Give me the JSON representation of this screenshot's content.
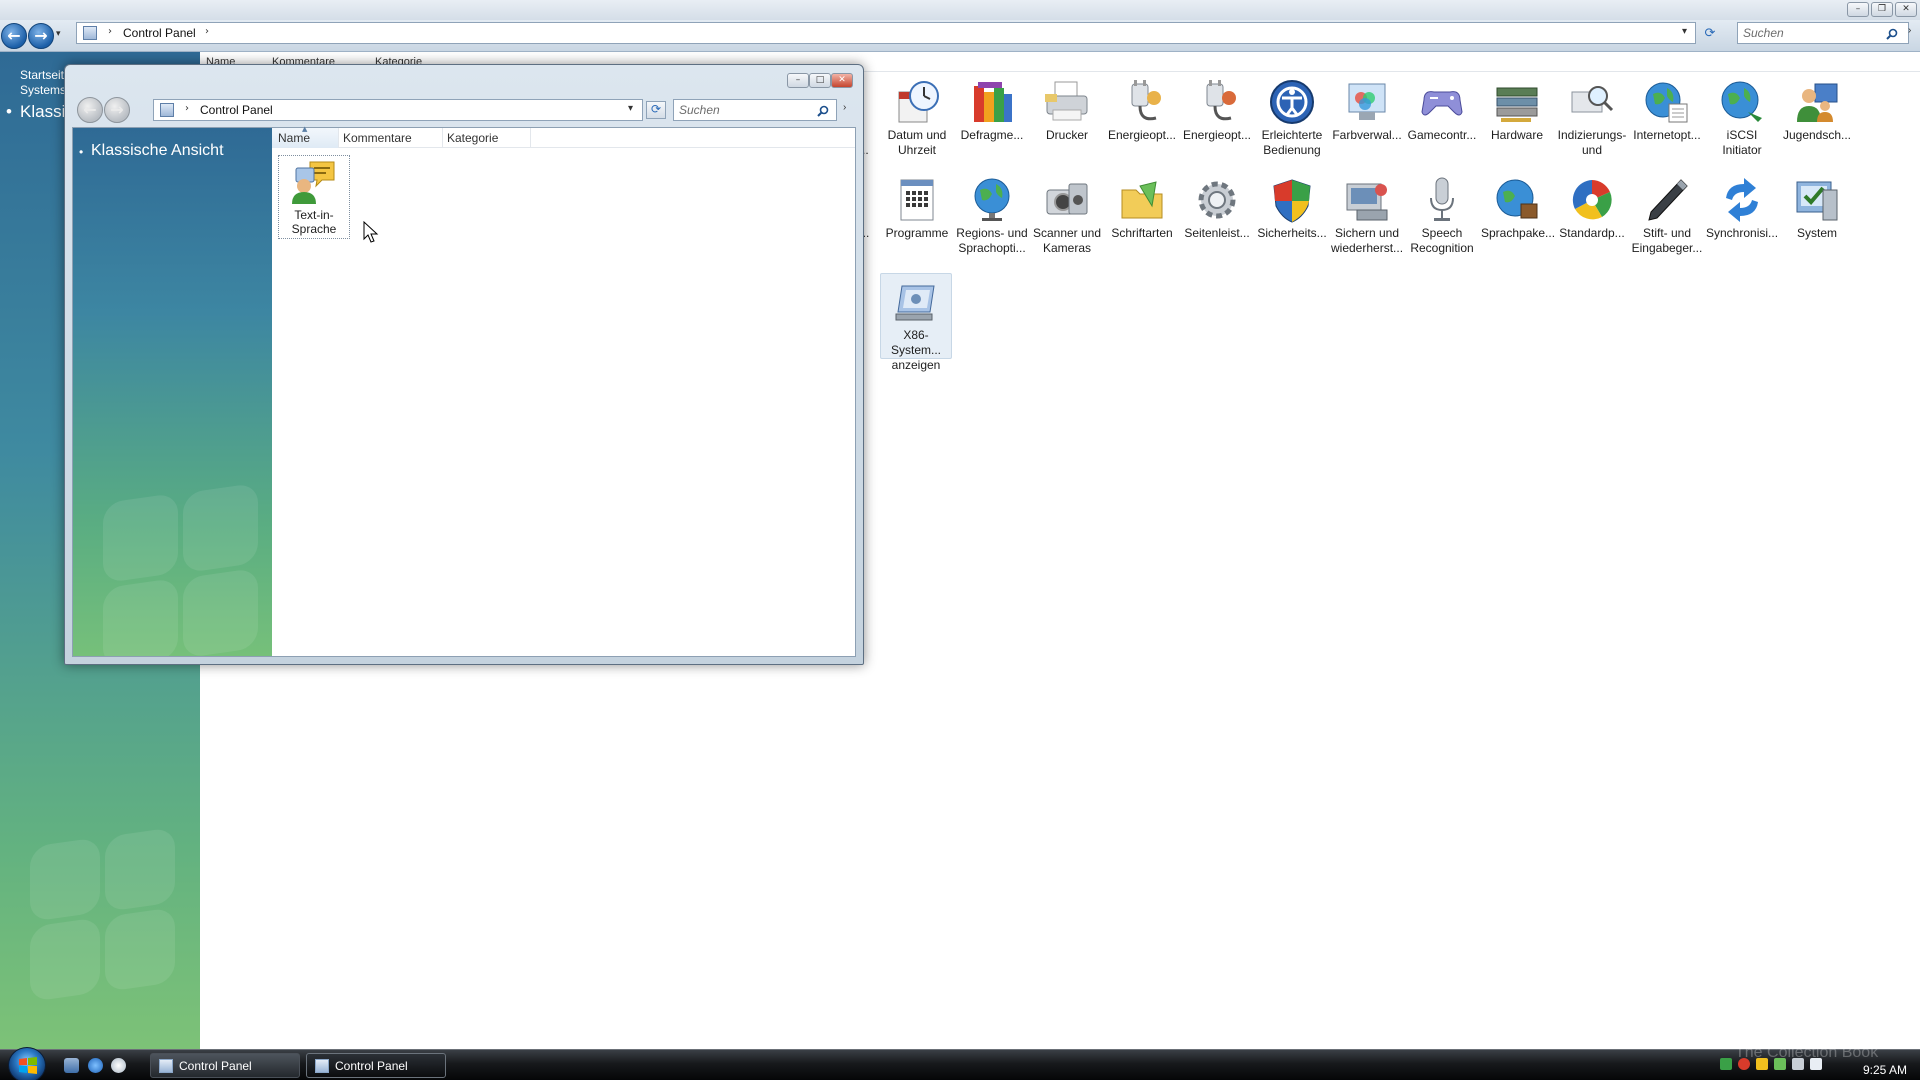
{
  "background_window": {
    "address": {
      "crumb": "Control Panel"
    },
    "search_placeholder": "Suchen",
    "sidebar": {
      "link_line1": "Startseite",
      "link_line2": "Systems",
      "classic_view": "Klassi"
    },
    "columns": [
      "Name",
      "Kommentare",
      "Kategorie"
    ],
    "icons_row1": [
      {
        "label": "d i...",
        "icon": "partial-icon"
      },
      {
        "label": "Datum und Uhrzeit",
        "icon": "clock-icon"
      },
      {
        "label": "Defragme...",
        "icon": "defragment-icon"
      },
      {
        "label": "Drucker",
        "icon": "printer-icon"
      },
      {
        "label": "Energieopt...",
        "icon": "power-plug-icon"
      },
      {
        "label": "Energieopt...",
        "icon": "power-plug-icon"
      },
      {
        "label": "Erleichterte Bedienung",
        "icon": "ease-of-access-icon"
      },
      {
        "label": "Farbverwal...",
        "icon": "color-management-icon"
      },
      {
        "label": "Gamecontr...",
        "icon": "gamepad-icon"
      },
      {
        "label": "Hardware",
        "icon": "hardware-icon"
      },
      {
        "label": "Indizierungs- und",
        "icon": "indexing-icon"
      },
      {
        "label": "Internetopt...",
        "icon": "internet-globe-icon"
      },
      {
        "label": "iSCSI Initiator",
        "icon": "iscsi-globe-icon"
      },
      {
        "label": "Jugendsch...",
        "icon": "parental-controls-icon"
      }
    ],
    "icons_row2": [
      {
        "label": "r...",
        "icon": "partial-icon"
      },
      {
        "label": "Programme",
        "icon": "programs-icon"
      },
      {
        "label": "Regions- und Sprachopti...",
        "icon": "regional-globe-icon"
      },
      {
        "label": "Scanner und Kameras",
        "icon": "scanner-camera-icon"
      },
      {
        "label": "Schriftarten",
        "icon": "fonts-folder-icon"
      },
      {
        "label": "Seitenleist...",
        "icon": "sidebar-gear-icon"
      },
      {
        "label": "Sicherheits...",
        "icon": "security-shield-icon"
      },
      {
        "label": "Sichern und wiederherst...",
        "icon": "backup-icon"
      },
      {
        "label": "Speech Recognition",
        "icon": "microphone-icon"
      },
      {
        "label": "Sprachpake...",
        "icon": "language-globe-icon"
      },
      {
        "label": "Standardp...",
        "icon": "default-programs-icon"
      },
      {
        "label": "Stift- und Eingabeger...",
        "icon": "pen-icon"
      },
      {
        "label": "Synchronisi...",
        "icon": "sync-icon"
      },
      {
        "label": "System",
        "icon": "system-icon"
      }
    ],
    "icons_row3": [
      {
        "label": "X86-System... anzeigen",
        "icon": "x86-system-icon"
      }
    ]
  },
  "foreground_window": {
    "address": {
      "crumb": "Control Panel"
    },
    "search_placeholder": "Suchen",
    "nav": {
      "classic_view": "Klassische Ansicht"
    },
    "columns": [
      "Name",
      "Kommentare",
      "Kategorie"
    ],
    "items": [
      {
        "label": "Text-in-Sprache",
        "icon": "text-to-speech-icon"
      }
    ]
  },
  "taskbar": {
    "buttons": [
      "Control Panel",
      "Control Panel"
    ],
    "clock": "9:25 AM",
    "watermark": "The Collection Book"
  },
  "colors": {
    "sidebar_top": "#2f6a95",
    "sidebar_bottom": "#7dc277",
    "selection": "#e6eef6"
  }
}
